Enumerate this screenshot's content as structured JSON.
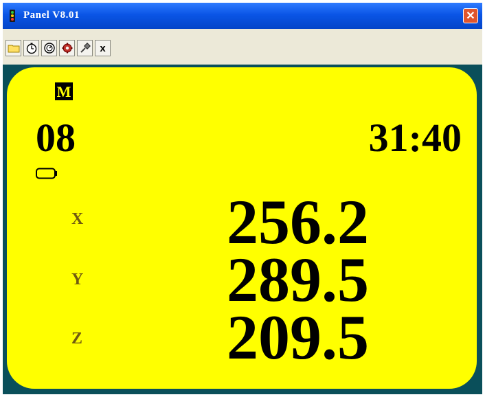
{
  "window": {
    "title": "Panel   V8.01"
  },
  "toolbar": {
    "buttons": [
      {
        "icon": "folder-icon"
      },
      {
        "icon": "timer-icon"
      },
      {
        "icon": "gauge-icon"
      },
      {
        "icon": "gear-icon"
      },
      {
        "icon": "probe-icon"
      },
      {
        "icon": "close-icon",
        "label": "x"
      }
    ]
  },
  "display": {
    "mode_label": "M",
    "program_number": "08",
    "time": "31:40",
    "axes": [
      {
        "label": "X",
        "value": "256.2"
      },
      {
        "label": "Y",
        "value": "289.5"
      },
      {
        "label": "Z",
        "value": "209.5"
      }
    ]
  },
  "colors": {
    "panel": "#ffff00",
    "frame": "#0a4f5a",
    "titlebar": "#0a55e6",
    "axis_label": "#705a10"
  }
}
